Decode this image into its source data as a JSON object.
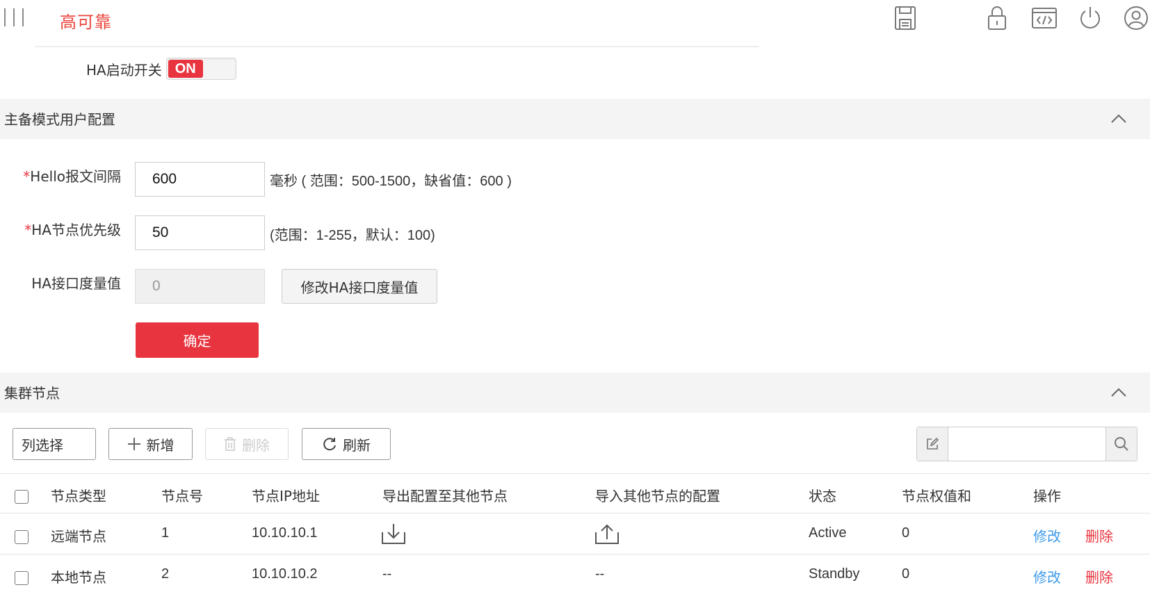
{
  "app": {
    "title": "高可靠"
  },
  "toolbar_icons": [
    "save-icon",
    "lock-icon",
    "code-icon",
    "power-icon",
    "user-icon"
  ],
  "ha_switch": {
    "label": "HA启动开关",
    "state": "ON"
  },
  "section_config": {
    "title": "主备模式用户配置",
    "hello_interval": {
      "label": "Hello报文间隔",
      "required_mark": "*",
      "value": "600",
      "hint": "毫秒 ( 范围：500-1500，缺省值：600 )"
    },
    "node_priority": {
      "label": "HA节点优先级",
      "required_mark": "*",
      "value": "50",
      "hint": "(范围：1-255，默认：100)"
    },
    "interface_metric": {
      "label": "HA接口度量值",
      "value": "0",
      "modify_button": "修改HA接口度量值"
    },
    "confirm_button": "确定"
  },
  "section_cluster": {
    "title": "集群节点",
    "toolbar": {
      "column_select": "列选择",
      "add": "新增",
      "delete": "删除",
      "refresh": "刷新",
      "search_placeholder": ""
    },
    "columns": [
      "节点类型",
      "节点号",
      "节点IP地址",
      "导出配置至其他节点",
      "导入其他节点的配置",
      "状态",
      "节点权值和",
      "操作"
    ],
    "rows": [
      {
        "type": "远端节点",
        "id": "1",
        "ip": "10.10.10.1",
        "export": "download-icon",
        "import": "upload-icon",
        "status": "Active",
        "weight": "0",
        "edit": "修改",
        "delete": "删除"
      },
      {
        "type": "本地节点",
        "id": "2",
        "ip": "10.10.10.2",
        "export": "--",
        "import": "--",
        "status": "Standby",
        "weight": "0",
        "edit": "修改",
        "delete": "删除"
      }
    ]
  },
  "colors": {
    "accent": "#e8343f",
    "link": "#3d9be9",
    "section_bg": "#f4f4f4"
  }
}
